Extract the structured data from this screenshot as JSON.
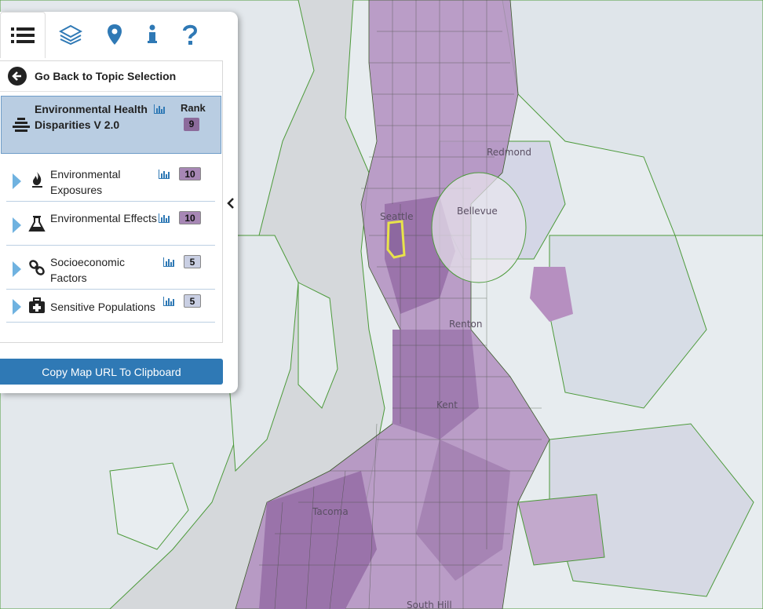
{
  "map": {
    "labels": [
      "Seattle",
      "Redmond",
      "Bellevue",
      "Renton",
      "Kent",
      "Tacoma",
      "South Hill"
    ]
  },
  "tabs": [
    {
      "icon": "list-icon"
    },
    {
      "icon": "layers-icon"
    },
    {
      "icon": "map-pin-icon"
    },
    {
      "icon": "info-icon"
    },
    {
      "icon": "help-icon"
    }
  ],
  "back_label": "Go Back to Topic Selection",
  "topic": {
    "title": "Environmental Health Disparities V 2.0",
    "rank_label": "Rank",
    "rank_value": "9",
    "icon": "layers-stack-icon"
  },
  "subtopics": [
    {
      "label": "Environmental Exposures",
      "rank": "10",
      "icon": "flame-icon",
      "badge_color": "#a787b5"
    },
    {
      "label": "Environmental Effects",
      "rank": "10",
      "icon": "flask-icon",
      "badge_color": "#a787b5"
    },
    {
      "label": "Socioeconomic Factors",
      "rank": "5",
      "icon": "chain-link-icon",
      "badge_color": "#c9cfe3"
    },
    {
      "label": "Sensitive Populations",
      "rank": "5",
      "icon": "medical-kit-icon",
      "badge_color": "#c9cfe3"
    }
  ],
  "copy_button": "Copy Map URL To Clipboard",
  "colors": {
    "water": "#d9dbdc",
    "land_light": "#e6ecef",
    "rank_purple": "#8c6b9b",
    "accent_blue": "#2f79b5",
    "boundary_green": "#4c9a3a"
  }
}
